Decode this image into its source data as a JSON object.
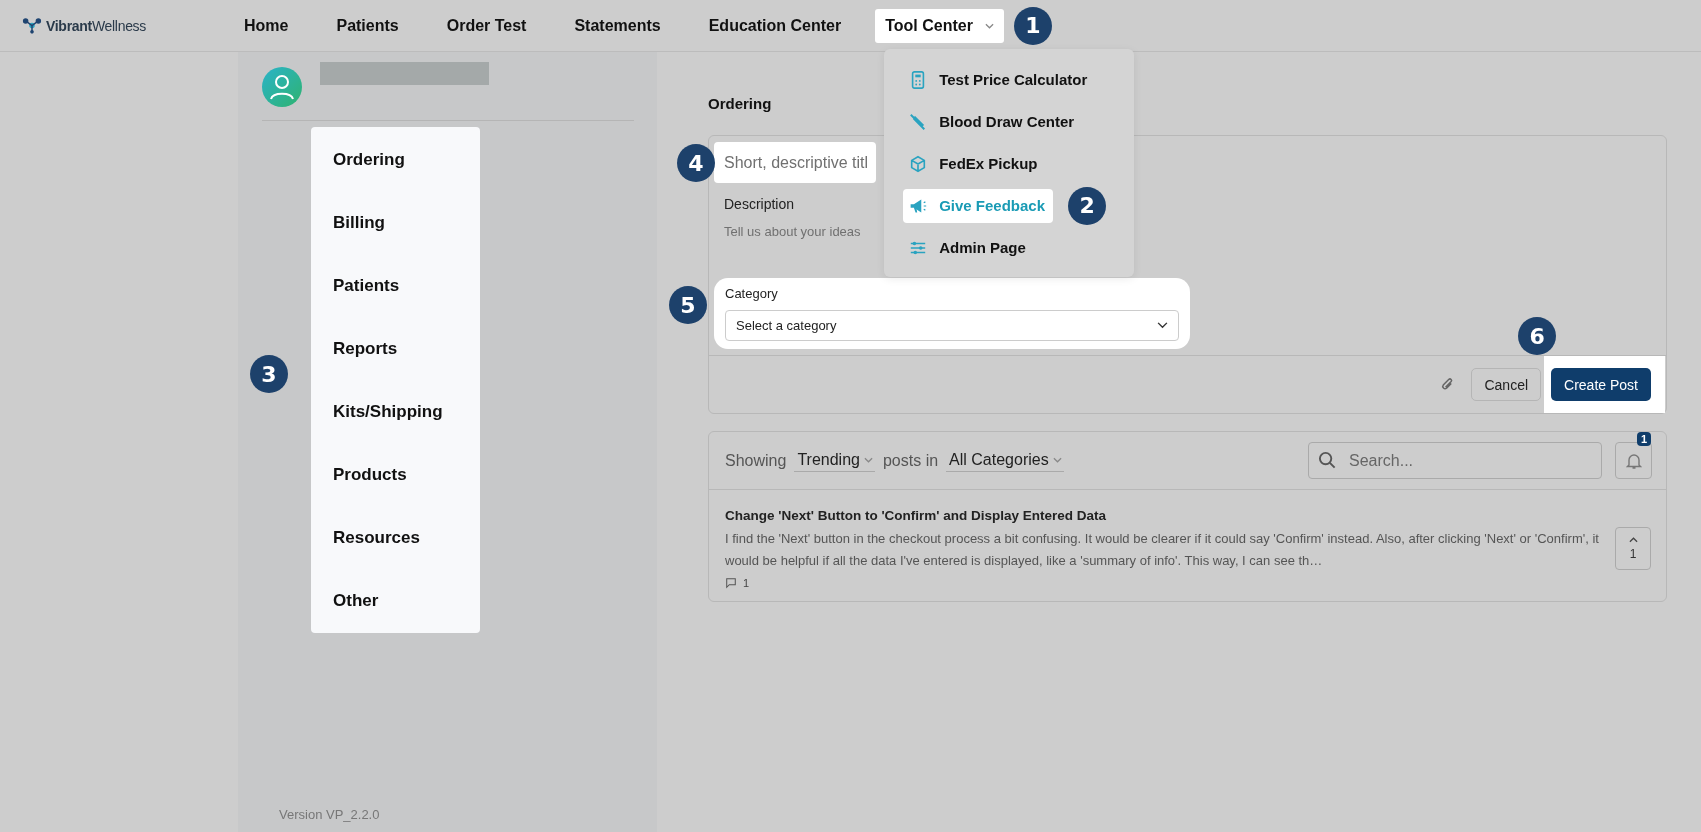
{
  "header": {
    "logo": "**Vibrant**Wellness",
    "nav": [
      {
        "label": "Home",
        "selected": false
      },
      {
        "label": "Patients",
        "selected": false
      },
      {
        "label": "Order Test",
        "selected": false
      },
      {
        "label": "Statements",
        "selected": false
      },
      {
        "label": "Education Center",
        "selected": false
      },
      {
        "label": "Tool Center",
        "selected": true,
        "kind": "dropdown",
        "callout": "1"
      }
    ],
    "tool_menu": {
      "callout": "2",
      "items": [
        {
          "label": "Test Price Calculator",
          "selected": false
        },
        {
          "label": "Blood Draw Center",
          "selected": false
        },
        {
          "label": "FedEx Pickup",
          "selected": false
        },
        {
          "label": "Give Feedback",
          "selected": true
        },
        {
          "label": "Admin Page",
          "selected": false
        }
      ]
    }
  },
  "sidebar": {
    "callout": "3",
    "menu": [
      "Ordering",
      "Billing",
      "Patients",
      "Reports",
      "Kits/Shipping",
      "Products",
      "Resources",
      "Other"
    ],
    "version": "Version VP_2.2.0"
  },
  "main": {
    "section_title": "Ordering",
    "form": {
      "title_placeholder": "Short, descriptive titl",
      "title_callout": "4",
      "description_label": "Description",
      "description_placeholder": "Tell us about your ideas",
      "category_label": "Category",
      "category_placeholder": "Select a category",
      "category_callout": "5",
      "cancel": "Cancel",
      "create": "Create Post",
      "create_callout": "6"
    },
    "feed": {
      "showing": "Showing",
      "sort": "Trending",
      "posts_in": "posts in",
      "category": "All Categories",
      "search_placeholder": "Search...",
      "notification_count": "1",
      "posts": [
        {
          "title": "Change 'Next' Button to 'Confirm' and Display Entered Data",
          "body": "I find the 'Next' button in the checkout process a bit confusing. It would be clearer if it could say 'Confirm' instead. Also, after clicking 'Next' or 'Confirm', it would be helpful if all the data I've entered is displayed, like a 'summary of info'. This way, I can see th…",
          "comments": "1",
          "votes": "1"
        }
      ]
    }
  }
}
